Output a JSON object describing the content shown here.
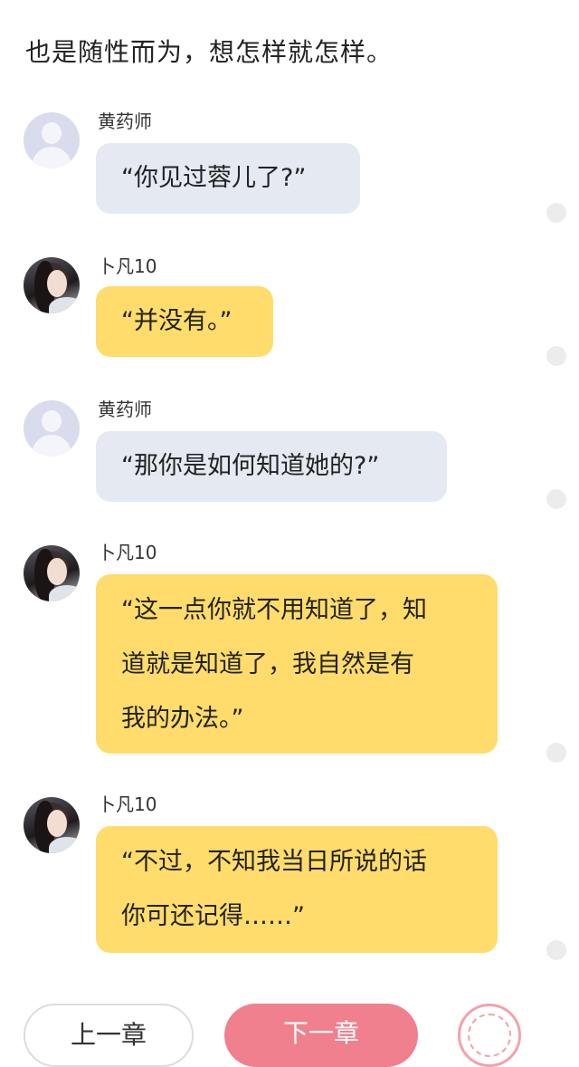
{
  "narration": "也是随性而为，想怎样就怎样。",
  "messages": [
    {
      "speaker": "黄药师",
      "text": "“你见过蓉儿了?”"
    },
    {
      "speaker": "卜凡10",
      "text": "“并没有。”"
    },
    {
      "speaker": "黄药师",
      "text": "“那你是如何知道她的?”"
    },
    {
      "speaker": "卜凡10",
      "lines": [
        "“这一点你就不用知道了，知",
        "道就是知道了，我自然是有",
        "我的办法。”"
      ]
    },
    {
      "speaker": "卜凡10",
      "lines": [
        "“不过，不知我当日所说的话",
        "你可还记得……”"
      ]
    }
  ],
  "buttons": {
    "prev_label": "上一章",
    "next_label": "下一章"
  },
  "colors": {
    "user_bubble": "#e4e9f2",
    "author_bubble": "#ffdc6b",
    "next_button": "#f0808d"
  }
}
